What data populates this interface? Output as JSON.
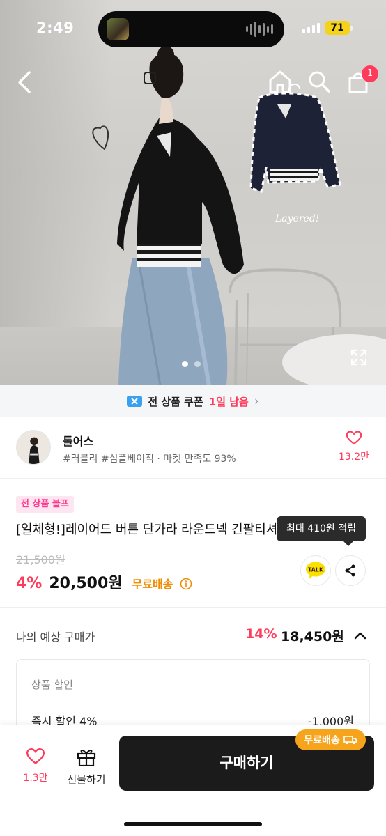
{
  "status": {
    "time": "2:49",
    "battery": "71"
  },
  "header": {
    "cart_count": "1"
  },
  "hero": {
    "annotation": "Layered!",
    "page_index": 1,
    "page_total": 2
  },
  "coupon": {
    "label": "전 상품 쿠폰",
    "remaining": "1일 남음"
  },
  "shop": {
    "name": "톨어스",
    "tags": "#러블리 #심플베이직 · 마켓 만족도 93%",
    "likes": "13.2만"
  },
  "product": {
    "badge": "전 상품 블프",
    "title": "[일체형!]레이어드 버튼 단가라 라운드넥 긴팔티셔츠",
    "original_price": "21,500원",
    "discount": "4%",
    "price": "20,500원",
    "shipping": "무료배송",
    "tooltip": "최대 410원 적립",
    "talk_label": "TALK"
  },
  "estimate": {
    "label": "나의 예상 구매가",
    "discount": "14%",
    "price": "18,450원"
  },
  "breakdown": {
    "heading": "상품 할인",
    "row_label": "즉시 할인 4%",
    "row_value": "-1,000원"
  },
  "bottom": {
    "wish_count": "1.3만",
    "gift_label": "선물하기",
    "buy_label": "구매하기",
    "free_badge": "무료배송"
  },
  "colors": {
    "accent_red": "#ff3b5c",
    "shipping_orange": "#f08c00",
    "buy_button": "#1b1b1b"
  }
}
